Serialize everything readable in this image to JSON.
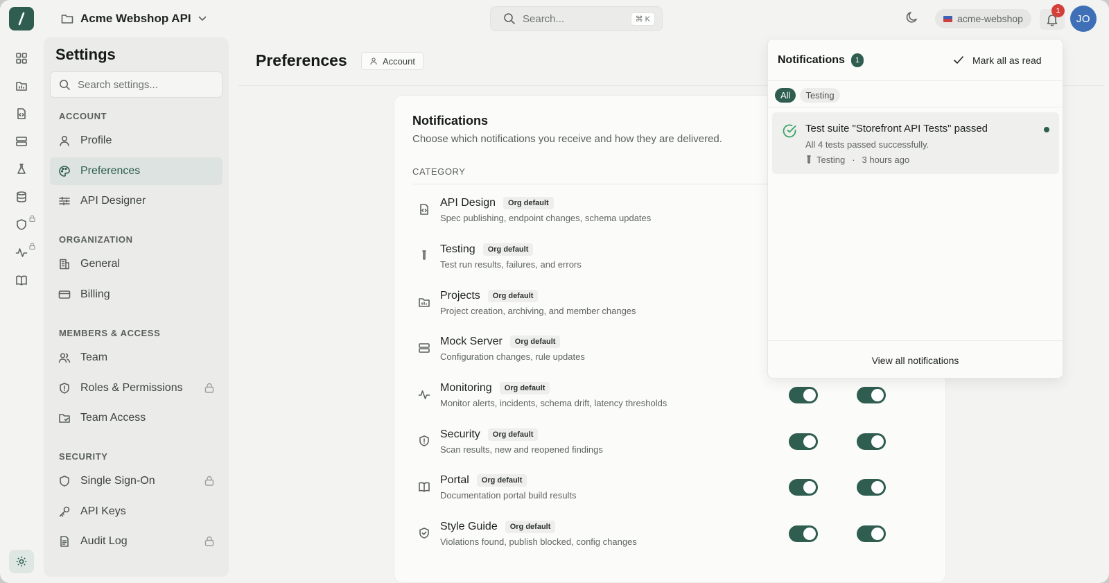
{
  "header": {
    "project_name": "Acme Webshop API",
    "search_placeholder": "Search...",
    "search_shortcut": "⌘ K",
    "workspace": "acme-webshop",
    "notification_count": "1",
    "avatar_initials": "JO"
  },
  "rail": {
    "items": [
      "dashboard-icon",
      "projects-icon",
      "api-design-icon",
      "mock-server-icon",
      "testing-icon",
      "database-icon",
      "security-icon",
      "monitoring-icon",
      "portal-icon"
    ],
    "bottom": "settings-icon"
  },
  "settings": {
    "title": "Settings",
    "search_placeholder": "Search settings...",
    "sections": {
      "account": "ACCOUNT",
      "organization": "ORGANIZATION",
      "members": "MEMBERS & ACCESS",
      "security": "SECURITY"
    },
    "items": {
      "profile": "Profile",
      "preferences": "Preferences",
      "api_designer": "API Designer",
      "general": "General",
      "billing": "Billing",
      "team": "Team",
      "roles": "Roles & Permissions",
      "team_access": "Team Access",
      "sso": "Single Sign-On",
      "api_keys": "API Keys",
      "audit_log": "Audit Log"
    }
  },
  "main": {
    "title": "Preferences",
    "scope_chip": "Account",
    "card": {
      "title": "Notifications",
      "description": "Choose which notifications you receive and how they are delivered.",
      "column_header": "CATEGORY",
      "badge": "Org default",
      "rows": [
        {
          "title": "API Design",
          "desc": "Spec publishing, endpoint changes, schema updates",
          "icon": "api-design-icon"
        },
        {
          "title": "Testing",
          "desc": "Test run results, failures, and errors",
          "icon": "test-tube-icon"
        },
        {
          "title": "Projects",
          "desc": "Project creation, archiving, and member changes",
          "icon": "folder-icon"
        },
        {
          "title": "Mock Server",
          "desc": "Configuration changes, rule updates",
          "icon": "server-icon"
        },
        {
          "title": "Monitoring",
          "desc": "Monitor alerts, incidents, schema drift, latency thresholds",
          "icon": "activity-icon"
        },
        {
          "title": "Security",
          "desc": "Scan results, new and reopened findings",
          "icon": "shield-icon"
        },
        {
          "title": "Portal",
          "desc": "Documentation portal build results",
          "icon": "book-icon"
        },
        {
          "title": "Style Guide",
          "desc": "Violations found, publish blocked, config changes",
          "icon": "shield-check-icon"
        }
      ]
    }
  },
  "notifications": {
    "title": "Notifications",
    "count": "1",
    "mark_all": "Mark all as read",
    "tabs": [
      "All",
      "Testing"
    ],
    "item": {
      "title": "Test suite \"Storefront API Tests\" passed",
      "body": "All 4 tests passed successfully.",
      "category": "Testing",
      "separator": "·",
      "time": "3 hours ago"
    },
    "footer": "View all notifications"
  },
  "colors": {
    "accent": "#2f5d50",
    "badge_red": "#d43f3a",
    "avatar_blue": "#3f70b7"
  }
}
